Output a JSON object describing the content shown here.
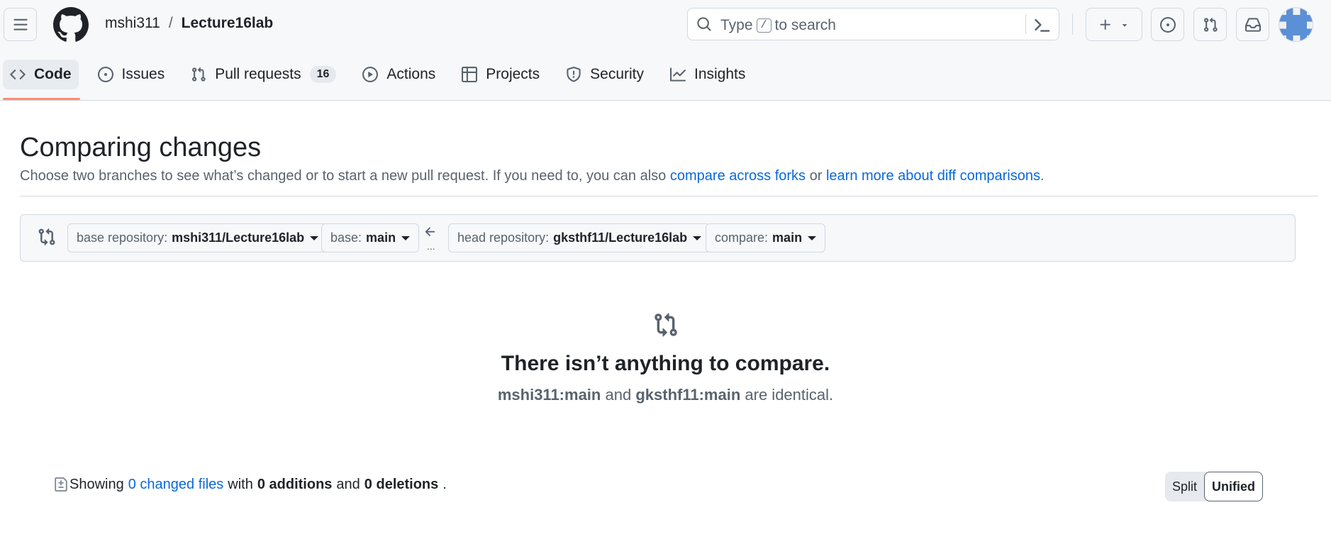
{
  "header": {
    "owner": "mshi311",
    "separator": "/",
    "repo": "Lecture16lab",
    "search": {
      "prefix": "Type",
      "key": "/",
      "suffix": "to search"
    }
  },
  "tabs": [
    {
      "label": "Code",
      "icon": "code-icon",
      "selected": true
    },
    {
      "label": "Issues",
      "icon": "issue-opened-icon"
    },
    {
      "label": "Pull requests",
      "icon": "git-pull-request-icon",
      "count": "16"
    },
    {
      "label": "Actions",
      "icon": "play-icon"
    },
    {
      "label": "Projects",
      "icon": "table-icon"
    },
    {
      "label": "Security",
      "icon": "shield-icon"
    },
    {
      "label": "Insights",
      "icon": "graph-icon"
    }
  ],
  "page": {
    "title": "Comparing changes",
    "subtitle_text": "Choose two branches to see what’s changed or to start a new pull request. If you need to, you can also",
    "compare_forks_link": "compare across forks",
    "or": "or",
    "learn_more_link": "learn more about diff comparisons",
    "period": "."
  },
  "range": {
    "base_repo_label": "base repository:",
    "base_repo_value": "mshi311/Lecture16lab",
    "base_label": "base:",
    "base_value": "main",
    "dots": "...",
    "head_repo_label": "head repository:",
    "head_repo_value": "gksthf11/Lecture16lab",
    "compare_label": "compare:",
    "compare_value": "main"
  },
  "blankslate": {
    "heading": "There isn’t anything to compare.",
    "left_ref": "mshi311:main",
    "and": "and",
    "right_ref": "gksthf11:main",
    "tail": "are identical."
  },
  "summary": {
    "showing": "Showing",
    "changed_files": "0 changed files",
    "with": "with",
    "additions": "0 additions",
    "and": "and",
    "deletions": "0 deletions",
    "period": "."
  },
  "view_toggle": {
    "split": "Split",
    "unified": "Unified",
    "selected": "Unified"
  },
  "colors": {
    "accent": "#0969da",
    "tab_underline": "#fd8c73",
    "muted": "#59636e",
    "header_bg": "#f6f8fa"
  }
}
